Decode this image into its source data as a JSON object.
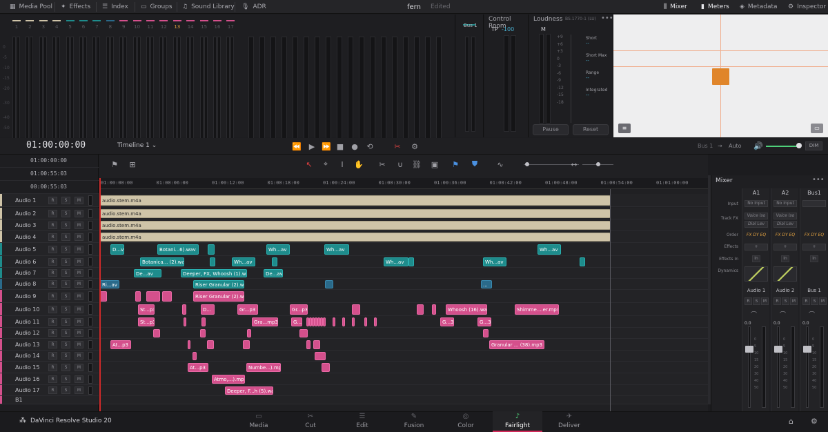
{
  "topbar": {
    "items": [
      "Media Pool",
      "Effects",
      "Index",
      "Groups",
      "Sound Library",
      "ADR"
    ],
    "right_items": [
      "Mixer",
      "Meters",
      "Metadata",
      "Inspector"
    ]
  },
  "project": {
    "name": "fern",
    "status": "Edited"
  },
  "channel_numbers": [
    "1",
    "2",
    "3",
    "4",
    "5",
    "6",
    "7",
    "8",
    "9",
    "10",
    "11",
    "12",
    "13",
    "14",
    "15",
    "16",
    "17"
  ],
  "meter_scale": [
    "0",
    "-5",
    "-10",
    "-15",
    "-20",
    "-30",
    "-40",
    "-50"
  ],
  "bus_label": "Bus 1",
  "control_room": {
    "title": "Control Room",
    "tp_label": "TP",
    "tp_value": "-100"
  },
  "loudness": {
    "title": "Loudness",
    "standard": "BS.1770-1 (LU)",
    "m_label": "M",
    "m_scale": [
      "+9",
      "+6",
      "+3",
      "0",
      "-3",
      "-6",
      "-9",
      "-12",
      "-15",
      "-18"
    ],
    "zero": "0",
    "stats": [
      {
        "label": "Short",
        "value": "--"
      },
      {
        "label": "Short Max",
        "value": "--"
      },
      {
        "label": "Range",
        "value": "--"
      },
      {
        "label": "Integrated",
        "value": "--"
      }
    ],
    "pause": "Pause",
    "reset": "Reset"
  },
  "transport": {
    "timecode": "01:00:00:00",
    "timeline": "Timeline 1",
    "output_bus": "Bus 1",
    "auto": "Auto",
    "dim": "DIM"
  },
  "timecodes": [
    "01:00:00:00",
    "01:00:55:03",
    "00:00:55:03"
  ],
  "ruler": [
    "01:00:00:00",
    "01:00:06:00",
    "01:00:12:00",
    "01:00:18:00",
    "01:00:24:00",
    "01:00:30:00",
    "01:00:36:00",
    "01:00:42:00",
    "01:00:48:00",
    "01:00:54:00",
    "01:01:00:00"
  ],
  "track_buttons": {
    "r": "R",
    "s": "S",
    "m": "M"
  },
  "tracks": [
    {
      "name": "Audio 1",
      "color": "#cfc4a8"
    },
    {
      "name": "Audio 2",
      "color": "#cfc4a8"
    },
    {
      "name": "Audio 3",
      "color": "#cfc4a8"
    },
    {
      "name": "Audio 4",
      "color": "#cfc4a8"
    },
    {
      "name": "Audio 5",
      "color": "#1e8c8c"
    },
    {
      "name": "Audio 6",
      "color": "#1e8c8c"
    },
    {
      "name": "Audio 7",
      "color": "#1e8c8c"
    },
    {
      "name": "Audio 8",
      "color": "#2a6a8a"
    },
    {
      "name": "Audio 9",
      "color": "#d4508c"
    },
    {
      "name": "Audio 10",
      "color": "#d4508c"
    },
    {
      "name": "Audio 11",
      "color": "#d4508c"
    },
    {
      "name": "Audio 12",
      "color": "#d4508c"
    },
    {
      "name": "Audio 13",
      "color": "#d4508c"
    },
    {
      "name": "Audio 14",
      "color": "#d4508c"
    },
    {
      "name": "Audio 15",
      "color": "#d4508c"
    },
    {
      "name": "Audio 16",
      "color": "#d4508c"
    },
    {
      "name": "Audio 17",
      "color": "#d4508c"
    },
    {
      "name": "B1",
      "color": "#d4508c"
    }
  ],
  "clip_labels": {
    "stem": "audio.stem.m4a",
    "c1": "D...v",
    "c2": "Botani...6).wav",
    "c3": "Wh...av",
    "c4": "Wh...av",
    "c5": "Wh...av",
    "c6": "Botanica... (2).wav",
    "c7": "Wh...av",
    "c8": "Wh...av",
    "c9": "Wh...av",
    "c10": "De...av",
    "c11": "Deeper, FX, Whoosh (1).wav",
    "c12": "De...av",
    "c13": "Ri...av",
    "c14": "Riser Granular (2).wav",
    "c15": "...",
    "c16": "Riser Granular (2).wav",
    "c17": "St...p3",
    "c18": "D...",
    "c19": "Gr...p3",
    "c20": "Gr...p3",
    "c21": "Whoosh (16).wav",
    "c22": "Shimme....er.mp3",
    "c23": "St...p3",
    "c24": "Gra...mp3",
    "c25": "G...",
    "c26": "G...3",
    "c27": "G...3",
    "c28": "At...p3",
    "c29": "Granular ... (38).mp3",
    "c30": "At...p3",
    "c31": "Numbe...).mp2",
    "c32": "Atmo,...).mp3",
    "c33": "Deeper, F...h (5).wav"
  },
  "mixer": {
    "title": "Mixer",
    "columns": [
      "A1",
      "A2",
      "Bus1"
    ],
    "row_labels": [
      "Input",
      "Track FX",
      "Order",
      "Effects",
      "Effects In",
      "Dynamics"
    ],
    "input": "No Input",
    "fx1": "Voice Iso",
    "fx2": "Dial Lev",
    "order": "FX DY EQ",
    "plus": "+",
    "in_label": "In",
    "strip_names": [
      "Audio 1",
      "Audio 2",
      "Bus 1"
    ],
    "gain": "0.0",
    "fader_scale": [
      "0",
      "5",
      "10",
      "15",
      "20",
      "30",
      "40",
      "50"
    ]
  },
  "app": {
    "name": "DaVinci Resolve Studio 20"
  },
  "pages": [
    "Media",
    "Cut",
    "Edit",
    "Fusion",
    "Color",
    "Fairlight",
    "Deliver"
  ],
  "accent": "#d22a5a"
}
